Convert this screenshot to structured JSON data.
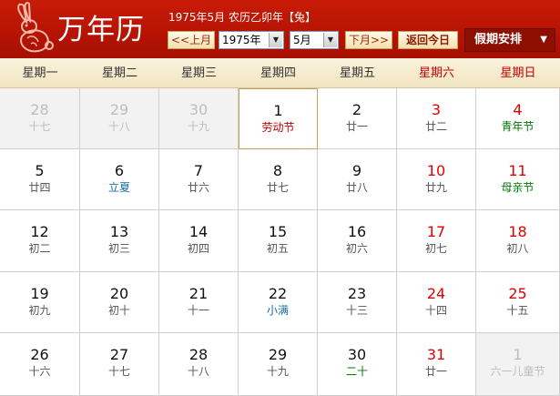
{
  "header": {
    "brand": "万年历",
    "lunar_info": "1975年5月 农历乙卯年【兔】",
    "prev_label": "<<上月",
    "year_select": "1975年",
    "month_select": "5月",
    "next_label": "下月>>",
    "today_label": "返回今日",
    "holiday_label": "假期安排"
  },
  "colors": {
    "header_red": "#b71404",
    "weekend_red": "#e00000",
    "festival_green": "#007a00",
    "term_blue": "#1a6f9e",
    "holiday_red": "#c00000"
  },
  "weekdays": [
    "星期一",
    "星期二",
    "星期三",
    "星期四",
    "星期五",
    "星期六",
    "星期日"
  ],
  "weeks": [
    [
      {
        "day": "28",
        "lunar": "十七",
        "other": true
      },
      {
        "day": "29",
        "lunar": "十八",
        "other": true
      },
      {
        "day": "30",
        "lunar": "十九",
        "other": true
      },
      {
        "day": "1",
        "lunar": "劳动节",
        "tone": "red"
      },
      {
        "day": "2",
        "lunar": "廿一"
      },
      {
        "day": "3",
        "lunar": "廿二"
      },
      {
        "day": "4",
        "lunar": "青年节",
        "tone": "green"
      }
    ],
    [
      {
        "day": "5",
        "lunar": "廿四"
      },
      {
        "day": "6",
        "lunar": "立夏",
        "tone": "blue"
      },
      {
        "day": "7",
        "lunar": "廿六"
      },
      {
        "day": "8",
        "lunar": "廿七"
      },
      {
        "day": "9",
        "lunar": "廿八"
      },
      {
        "day": "10",
        "lunar": "廿九"
      },
      {
        "day": "11",
        "lunar": "母亲节",
        "tone": "green"
      }
    ],
    [
      {
        "day": "12",
        "lunar": "初二"
      },
      {
        "day": "13",
        "lunar": "初三"
      },
      {
        "day": "14",
        "lunar": "初四"
      },
      {
        "day": "15",
        "lunar": "初五"
      },
      {
        "day": "16",
        "lunar": "初六"
      },
      {
        "day": "17",
        "lunar": "初七"
      },
      {
        "day": "18",
        "lunar": "初八"
      }
    ],
    [
      {
        "day": "19",
        "lunar": "初九"
      },
      {
        "day": "20",
        "lunar": "初十"
      },
      {
        "day": "21",
        "lunar": "十一"
      },
      {
        "day": "22",
        "lunar": "小满",
        "tone": "blue"
      },
      {
        "day": "23",
        "lunar": "十三"
      },
      {
        "day": "24",
        "lunar": "十四"
      },
      {
        "day": "25",
        "lunar": "十五"
      }
    ],
    [
      {
        "day": "26",
        "lunar": "十六"
      },
      {
        "day": "27",
        "lunar": "十七"
      },
      {
        "day": "28",
        "lunar": "十八"
      },
      {
        "day": "29",
        "lunar": "十九"
      },
      {
        "day": "30",
        "lunar": "二十",
        "tone": "green"
      },
      {
        "day": "31",
        "lunar": "廿一"
      },
      {
        "day": "1",
        "lunar": "六一儿童节",
        "tone": "green",
        "other": true
      }
    ]
  ]
}
